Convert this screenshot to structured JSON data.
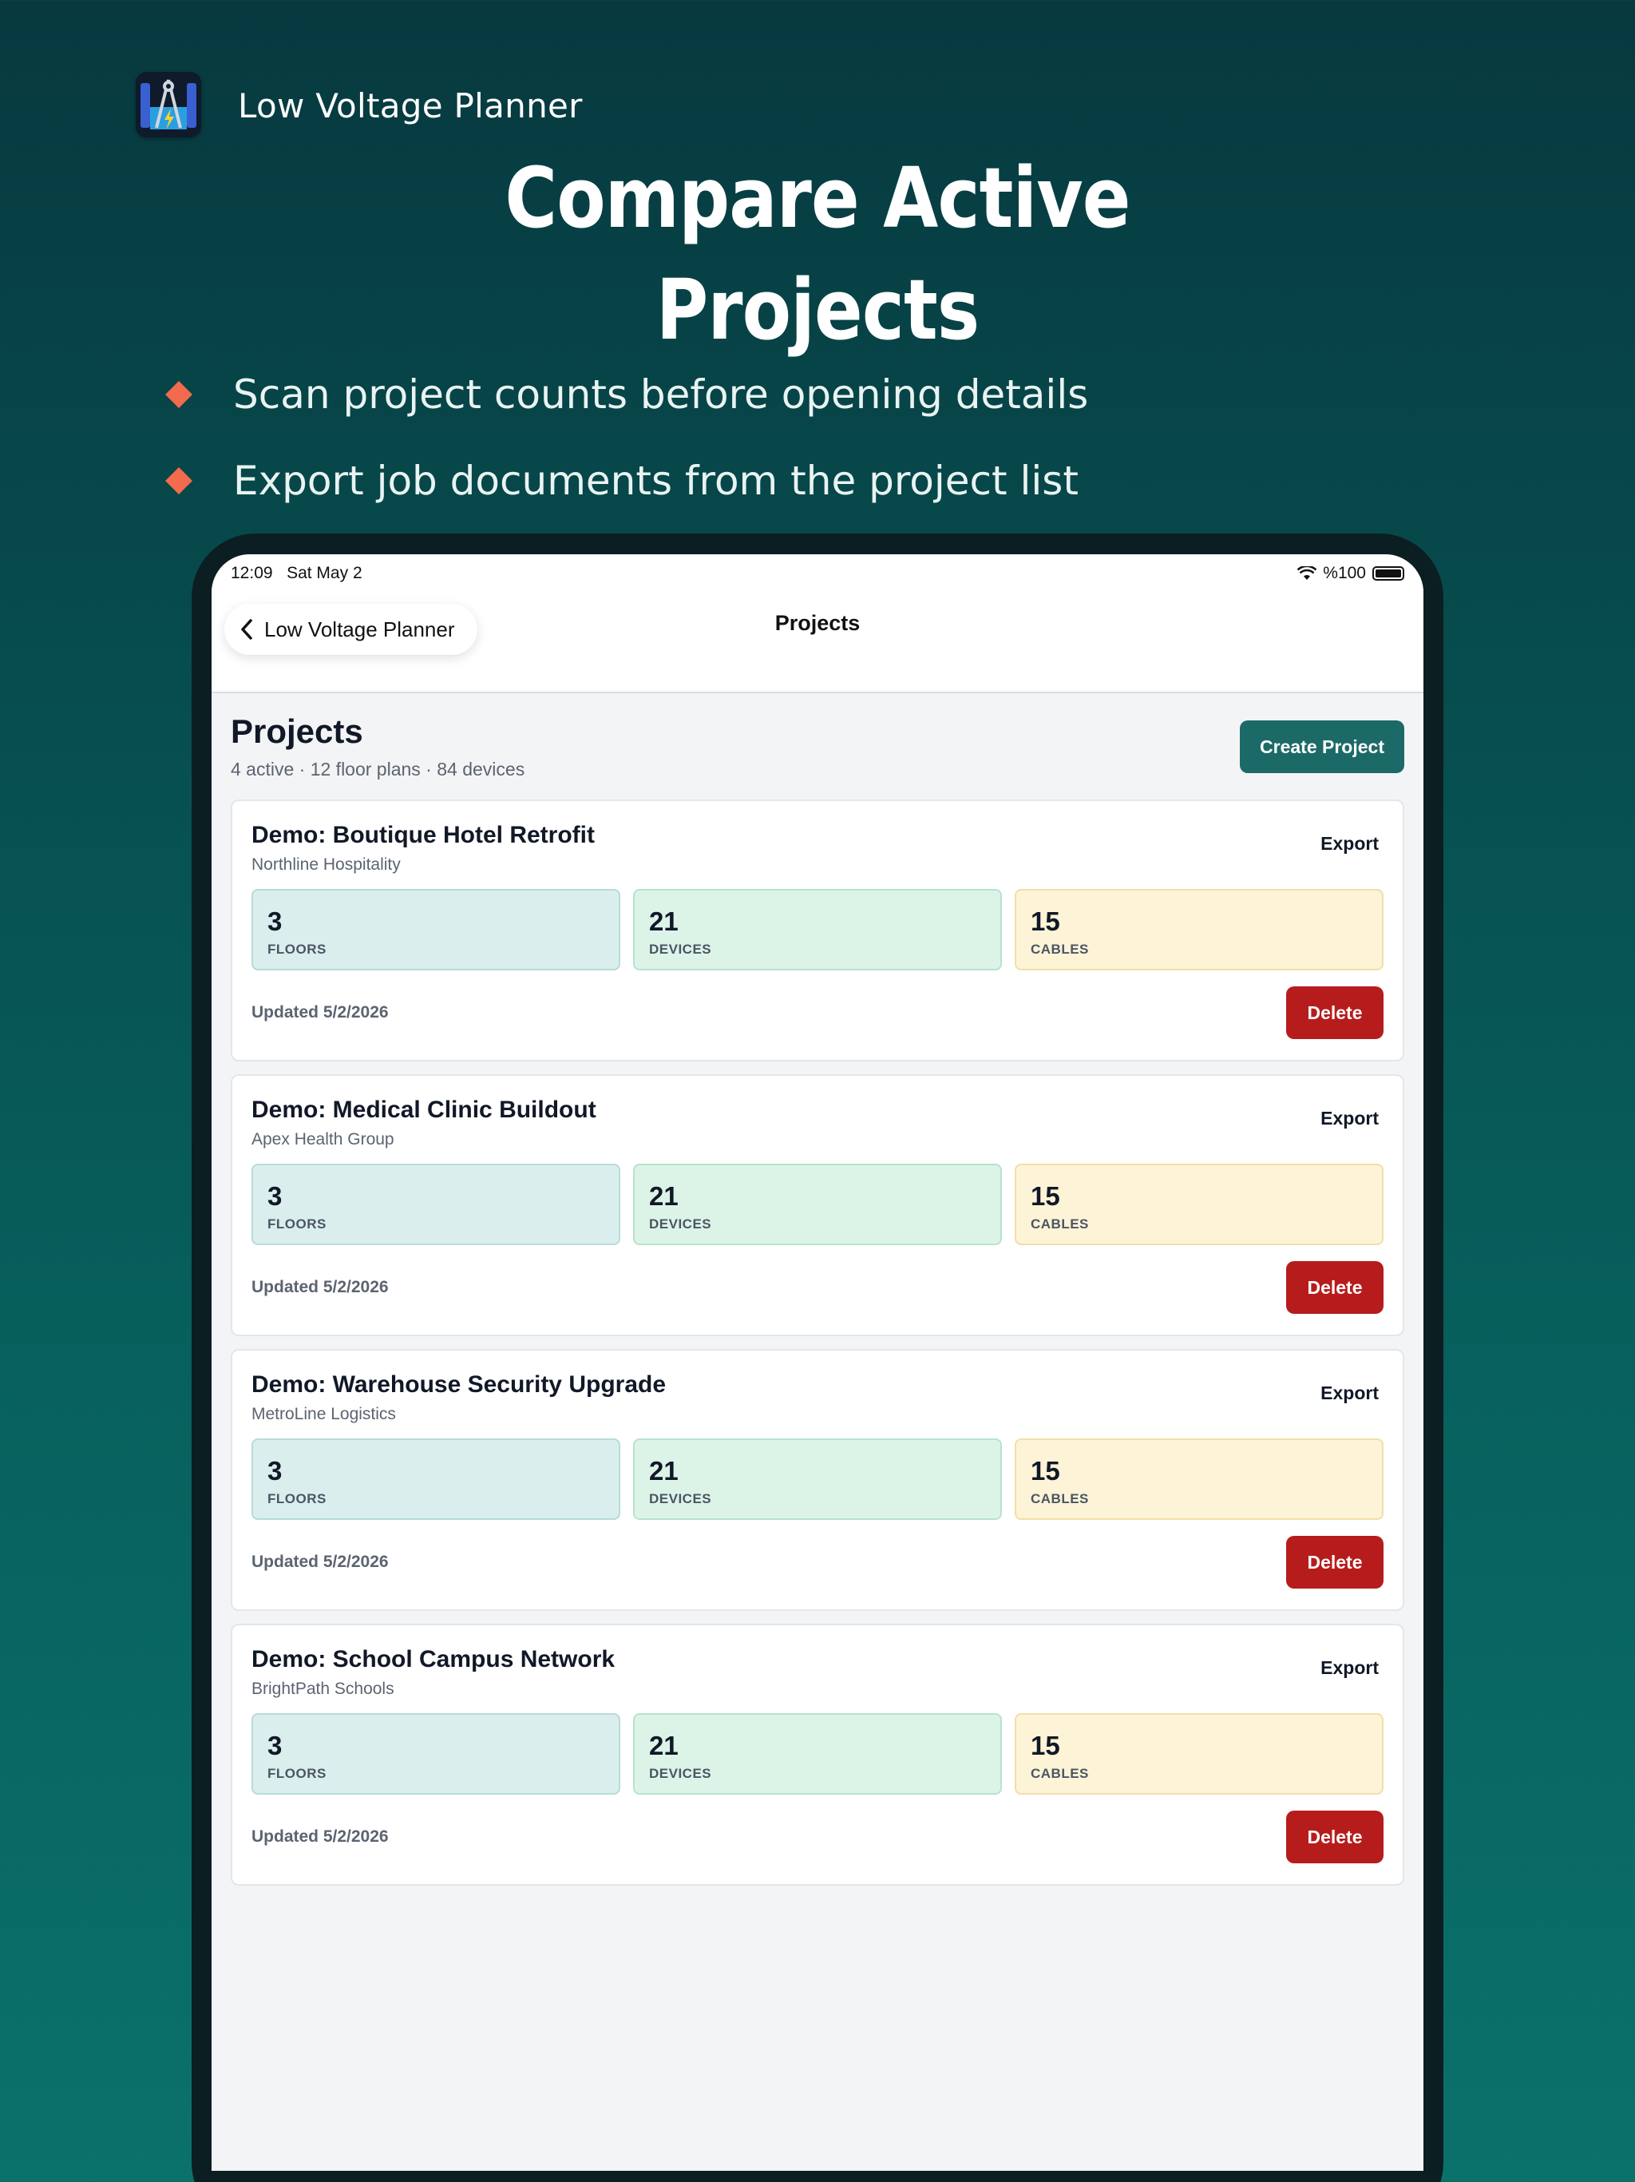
{
  "promo": {
    "app_name": "Low Voltage Planner",
    "headline": "Compare Active Projects",
    "bullets": [
      "Scan project counts before opening details",
      "Export job documents from the project list"
    ],
    "accent_color": "#f26b4e"
  },
  "status_bar": {
    "time": "12:09",
    "date": "Sat May 2",
    "battery": "%100"
  },
  "navbar": {
    "back_label": "Low Voltage Planner",
    "title": "Projects"
  },
  "page": {
    "title": "Projects",
    "subtitle": "4 active · 12 floor plans · 84 devices",
    "create_label": "Create Project"
  },
  "projects": [
    {
      "name": "Demo: Boutique Hotel Retrofit",
      "client": "Northline Hospitality",
      "floors": "3",
      "devices": "21",
      "cables": "15",
      "updated": "Updated 5/2/2026",
      "export_label": "Export",
      "delete_label": "Delete"
    },
    {
      "name": "Demo: Medical Clinic Buildout",
      "client": "Apex Health Group",
      "floors": "3",
      "devices": "21",
      "cables": "15",
      "updated": "Updated 5/2/2026",
      "export_label": "Export",
      "delete_label": "Delete"
    },
    {
      "name": "Demo: Warehouse Security Upgrade",
      "client": "MetroLine Logistics",
      "floors": "3",
      "devices": "21",
      "cables": "15",
      "updated": "Updated 5/2/2026",
      "export_label": "Export",
      "delete_label": "Delete"
    },
    {
      "name": "Demo: School Campus Network",
      "client": "BrightPath Schools",
      "floors": "3",
      "devices": "21",
      "cables": "15",
      "updated": "Updated 5/2/2026",
      "export_label": "Export",
      "delete_label": "Delete"
    }
  ],
  "stat_labels": {
    "floors": "FLOORS",
    "devices": "DEVICES",
    "cables": "CABLES"
  },
  "colors": {
    "primary": "#1c6a68",
    "danger": "#b71c1c"
  }
}
